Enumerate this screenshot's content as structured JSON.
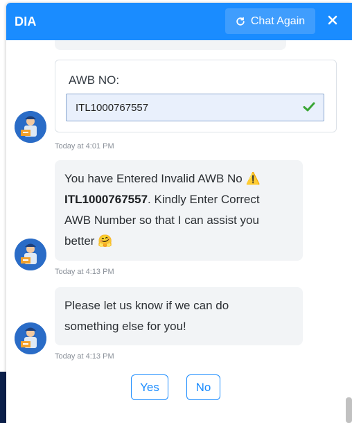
{
  "header": {
    "title": "DIA",
    "chat_again_label": "Chat Again",
    "close_symbol": "✕"
  },
  "awb_form": {
    "label": "AWB NO:",
    "value": "ITL1000767557",
    "timestamp": "Today at 4:01 PM"
  },
  "messages": [
    {
      "parts": [
        "You have Entered Invalid AWB No ⚠️",
        "ITL1000767557",
        ". Kindly Enter Correct",
        "AWB Number so that I can assist you",
        "better 🤗"
      ],
      "timestamp": "Today at 4:13 PM"
    },
    {
      "lines": [
        "Please let us know if we can do",
        "something else for you!"
      ],
      "timestamp": "Today at 4:13 PM"
    }
  ],
  "quick_replies": [
    "Yes",
    "No"
  ],
  "colors": {
    "header_bg": "#1a8cff",
    "accent": "#1a8cff",
    "bubble_bg": "#f2f4f6",
    "check_green": "#3aa635"
  }
}
